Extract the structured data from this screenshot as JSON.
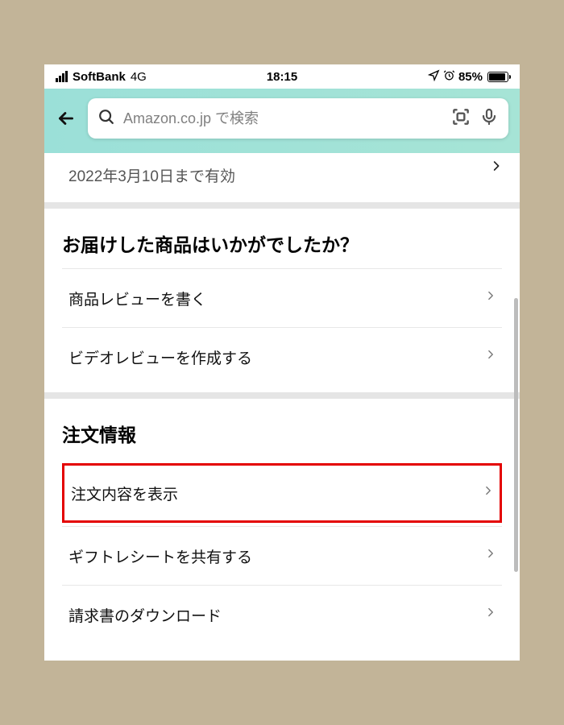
{
  "status_bar": {
    "carrier": "SoftBank",
    "network": "4G",
    "time": "18:15",
    "battery_pct": "85%"
  },
  "search": {
    "placeholder": "Amazon.co.jp で検索"
  },
  "note": {
    "valid_until": "2022年3月10日まで有効"
  },
  "feedback_section": {
    "title": "お届けした商品はいかがでしたか？",
    "write_review": "商品レビューを書く",
    "create_video": "ビデオレビューを作成する"
  },
  "order_info_section": {
    "title": "注文情報",
    "show_order": "注文内容を表示",
    "share_gift_receipt": "ギフトレシートを共有する",
    "download_invoice": "請求書のダウンロード"
  }
}
